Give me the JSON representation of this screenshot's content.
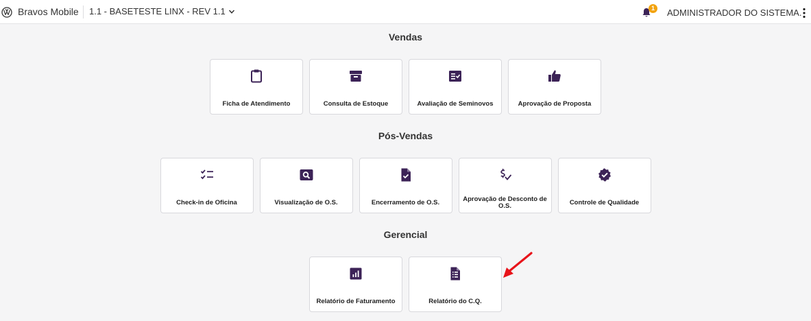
{
  "header": {
    "app_title": "Bravos Mobile",
    "version": "1.1 - BASETESTE LINX - REV 1.1",
    "notification_count": "1",
    "user_name": "ADMINISTRADOR DO SISTEMA."
  },
  "colors": {
    "icon": "#3c2357",
    "badge": "#f2a30f",
    "arrow": "#e8141b"
  },
  "sections": {
    "vendas": {
      "title": "Vendas",
      "items": [
        {
          "label": "Ficha de Atendimento",
          "icon": "clipboard-icon"
        },
        {
          "label": "Consulta de Estoque",
          "icon": "archive-box-icon"
        },
        {
          "label": "Avaliação de Seminovos",
          "icon": "checklist-card-icon"
        },
        {
          "label": "Aprovação de Proposta",
          "icon": "thumbs-up-icon"
        }
      ]
    },
    "pos_vendas": {
      "title": "Pós-Vendas",
      "items": [
        {
          "label": "Check-in de Oficina",
          "icon": "checklist-icon"
        },
        {
          "label": "Visualização de O.S.",
          "icon": "magnifier-card-icon"
        },
        {
          "label": "Encerramento de O.S.",
          "icon": "file-check-icon"
        },
        {
          "label": "Aprovação de Desconto de O.S.",
          "icon": "dollar-check-icon"
        },
        {
          "label": "Controle de Qualidade",
          "icon": "verified-badge-icon"
        }
      ]
    },
    "gerencial": {
      "title": "Gerencial",
      "items": [
        {
          "label": "Relatório de Faturamento",
          "icon": "bar-chart-icon"
        },
        {
          "label": "Relatório do C.Q.",
          "icon": "document-list-icon"
        }
      ]
    }
  }
}
